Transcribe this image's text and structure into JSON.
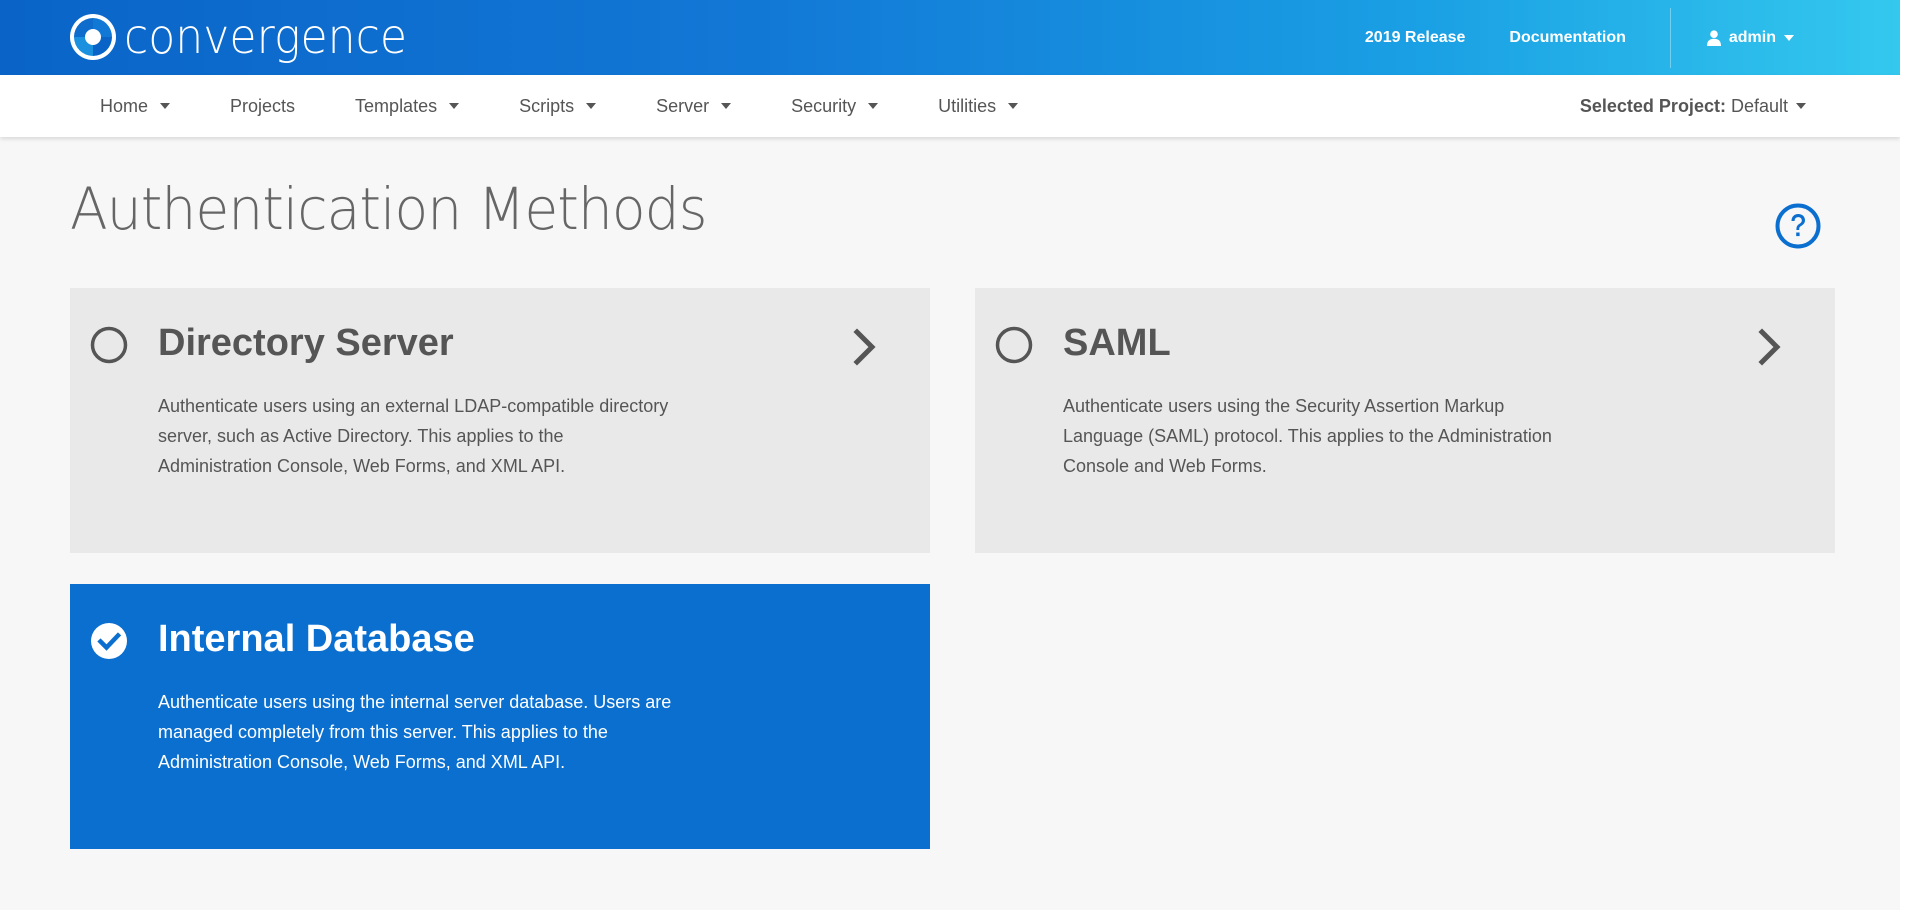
{
  "brand": {
    "name": "convergence"
  },
  "topbar": {
    "release_link": "2019 Release",
    "documentation_link": "Documentation",
    "user_label": "admin"
  },
  "nav": {
    "items": [
      {
        "label": "Home",
        "has_dropdown": true
      },
      {
        "label": "Projects",
        "has_dropdown": false
      },
      {
        "label": "Templates",
        "has_dropdown": true
      },
      {
        "label": "Scripts",
        "has_dropdown": true
      },
      {
        "label": "Server",
        "has_dropdown": true
      },
      {
        "label": "Security",
        "has_dropdown": true
      },
      {
        "label": "Utilities",
        "has_dropdown": true
      }
    ],
    "selected_project_label": "Selected Project:",
    "selected_project_value": "Default"
  },
  "page": {
    "title": "Authentication Methods"
  },
  "methods": [
    {
      "title": "Directory Server",
      "description": "Authenticate users using an external LDAP-compatible directory server, such as Active Directory. This applies to the Administration Console, Web Forms, and XML API.",
      "selected": false,
      "has_chevron": true
    },
    {
      "title": "SAML",
      "description": "Authenticate users using the Security Assertion Markup Language (SAML) protocol. This applies to the Administration Console and Web Forms.",
      "selected": false,
      "has_chevron": true
    },
    {
      "title": "Internal Database",
      "description": "Authenticate users using the internal server database. Users are managed completely from this server. This applies to the Administration Console, Web Forms, and XML API.",
      "selected": true,
      "has_chevron": false
    }
  ],
  "colors": {
    "accent": "#0a6fcf",
    "card_bg": "#e9e9e9",
    "text": "#555555"
  },
  "icons": {
    "help": "question-circle-icon",
    "user": "user-icon",
    "unselected": "radio-empty-icon",
    "selected": "check-circle-icon",
    "chevron": "chevron-right-icon"
  }
}
